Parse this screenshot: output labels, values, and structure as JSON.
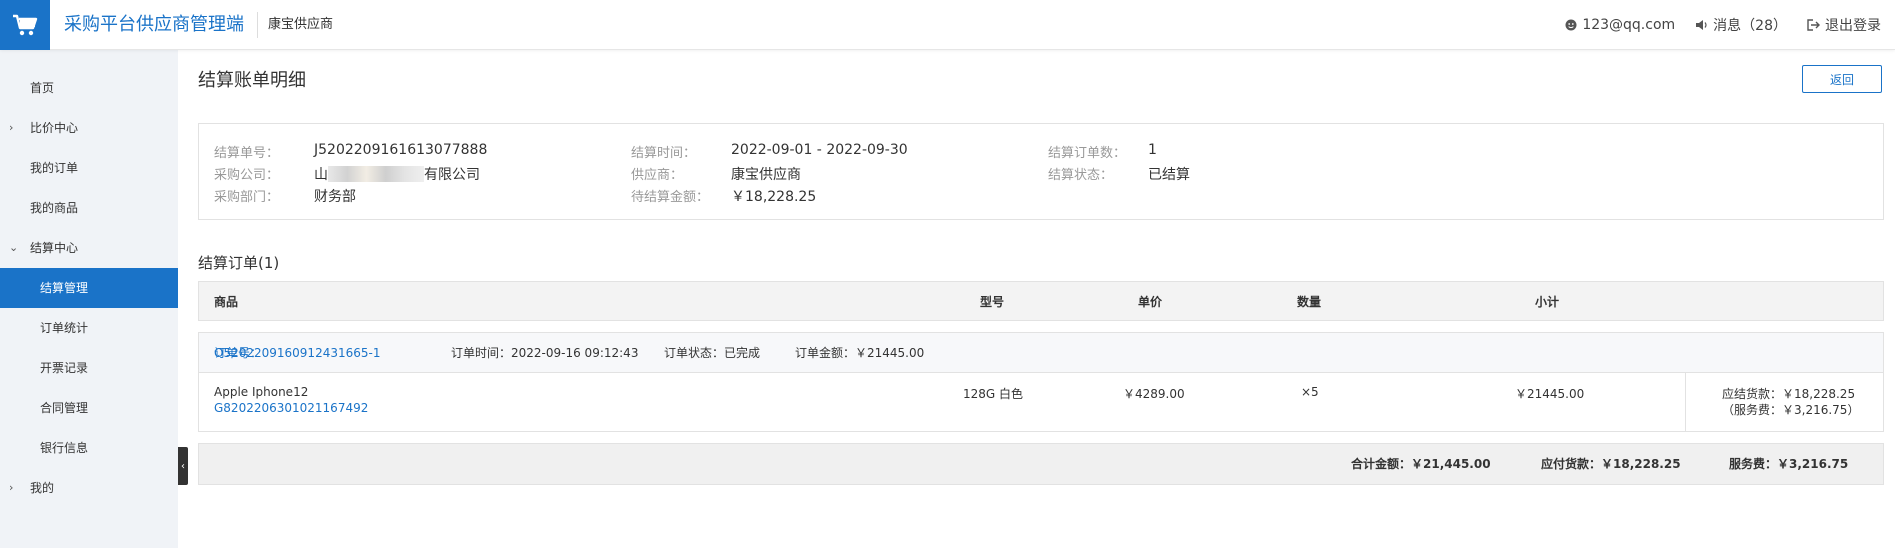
{
  "header": {
    "logo_icon": "shopping-cart-icon",
    "app_title": "采购平台供应商管理端",
    "supplier_name": "康宝供应商",
    "user_email": "123@qq.com",
    "messages_label": "消息（28）",
    "logout_label": "退出登录",
    "accent_color": "#1a73c8"
  },
  "sidebar": {
    "items": [
      {
        "label": "首页",
        "expand": ""
      },
      {
        "label": "比价中心",
        "expand": "›"
      },
      {
        "label": "我的订单",
        "expand": ""
      },
      {
        "label": "我的商品",
        "expand": ""
      },
      {
        "label": "结算中心",
        "expand": "⌄"
      },
      {
        "label": "结算管理",
        "expand": ""
      },
      {
        "label": "订单统计",
        "expand": ""
      },
      {
        "label": "开票记录",
        "expand": ""
      },
      {
        "label": "合同管理",
        "expand": ""
      },
      {
        "label": "银行信息",
        "expand": ""
      },
      {
        "label": "我的",
        "expand": "›"
      }
    ],
    "collapse_icon": "‹"
  },
  "page": {
    "title": "结算账单明细",
    "back_button": "返回"
  },
  "summary": {
    "bill_no_label": "结算单号：",
    "bill_no": "J5202209161613077888",
    "company_label": "采购公司：",
    "company_prefix": "山",
    "company_suffix": "有限公司",
    "dept_label": "采购部门：",
    "dept": "财务部",
    "period_label": "结算时间：",
    "period": "2022-09-01 - 2022-09-30",
    "supplier_label": "供应商：",
    "supplier": "康宝供应商",
    "pending_label": "待结算金额：",
    "pending": "￥18,228.25",
    "order_count_label": "结算订单数：",
    "order_count": "1",
    "status_label": "结算状态：",
    "status": "已结算"
  },
  "orders_section": {
    "title": "结算订单(1)",
    "columns": [
      "商品",
      "型号",
      "单价",
      "数量",
      "小计"
    ],
    "order": {
      "order_no_label": "订单号：",
      "order_no": "O5202209160912431665-1",
      "order_time": "订单时间：2022-09-16 09:12:43",
      "order_status": "订单状态：已完成",
      "order_amount": "订单金额：￥21445.00",
      "item": {
        "name": "Apple Iphone12",
        "sku": "G8202206301021167492",
        "model": "128G 白色",
        "unit_price": "￥4289.00",
        "quantity": "×5",
        "subtotal": "￥21445.00",
        "payable": "应结货款：￥18,228.25",
        "service_fee": "（服务费：￥3,216.75）"
      }
    }
  },
  "totals": {
    "total_amount": "合计金额：￥21,445.00",
    "payable_amount": "应付货款：￥18,228.25",
    "service_fee": "服务费：￥3,216.75"
  }
}
